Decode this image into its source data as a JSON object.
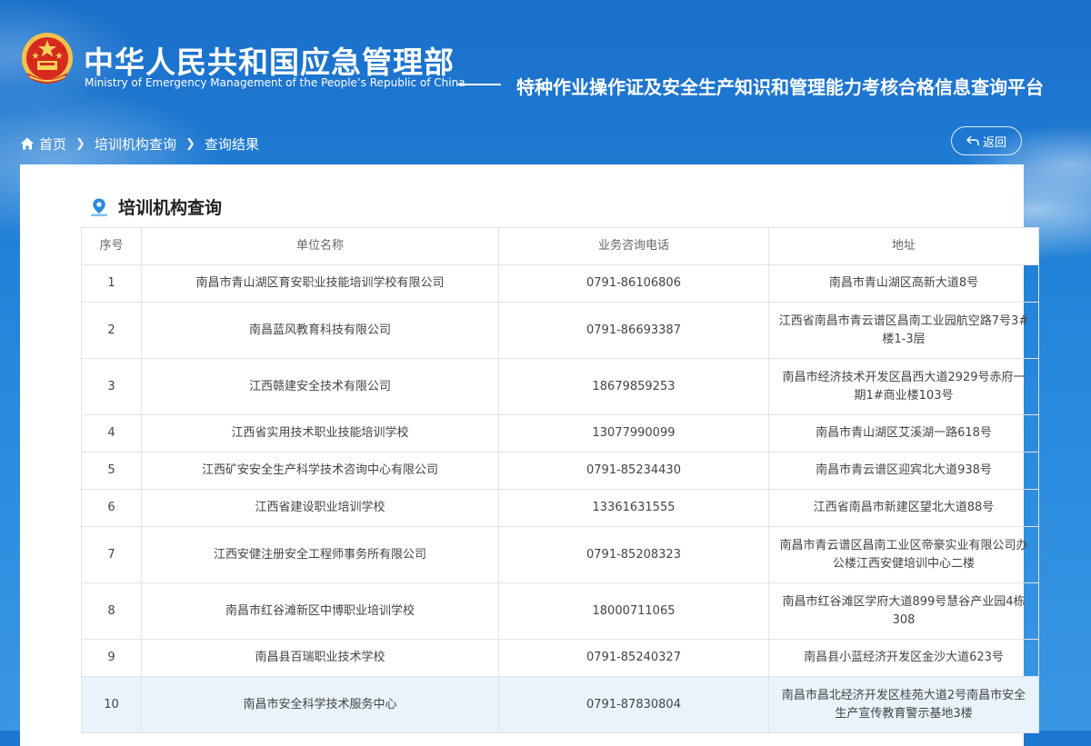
{
  "header": {
    "title_cn": "中华人民共和国应急管理部",
    "title_en": "Ministry of Emergency Management of the People’s Republic of China",
    "platform_title": "特种作业操作证及安全生产知识和管理能力考核合格信息查询平台"
  },
  "breadcrumb": {
    "items": [
      "首页",
      "培训机构查询",
      "查询结果"
    ]
  },
  "back_button": {
    "label": "返回"
  },
  "section": {
    "title": "培训机构查询"
  },
  "table": {
    "headers": [
      "序号",
      "单位名称",
      "业务咨询电话",
      "地址"
    ],
    "rows": [
      {
        "no": "1",
        "name": "南昌市青山湖区育安职业技能培训学校有限公司",
        "phone": "0791-86106806",
        "address": "南昌市青山湖区高新大道8号"
      },
      {
        "no": "2",
        "name": "南昌蓝风教育科技有限公司",
        "phone": "0791-86693387",
        "address": "江西省南昌市青云谱区昌南工业园航空路7号3#楼1-3层"
      },
      {
        "no": "3",
        "name": "江西赣建安全技术有限公司",
        "phone": "18679859253",
        "address": "南昌市经济技术开发区昌西大道2929号赤府一期1#商业楼103号"
      },
      {
        "no": "4",
        "name": "江西省实用技术职业技能培训学校",
        "phone": "13077990099",
        "address": "南昌市青山湖区艾溪湖一路618号"
      },
      {
        "no": "5",
        "name": "江西矿安安全生产科学技术咨询中心有限公司",
        "phone": "0791-85234430",
        "address": "南昌市青云谱区迎宾北大道938号"
      },
      {
        "no": "6",
        "name": "江西省建设职业培训学校",
        "phone": "13361631555",
        "address": "江西省南昌市新建区望北大道88号"
      },
      {
        "no": "7",
        "name": "江西安健注册安全工程师事务所有限公司",
        "phone": "0791-85208323",
        "address": "南昌市青云谱区昌南工业区帝豪实业有限公司办公楼江西安健培训中心二楼"
      },
      {
        "no": "8",
        "name": "南昌市红谷滩新区中博职业培训学校",
        "phone": "18000711065",
        "address": "南昌市红谷滩区学府大道899号慧谷产业园4栋308"
      },
      {
        "no": "9",
        "name": "南昌县百瑞职业技术学校",
        "phone": "0791-85240327",
        "address": "南昌县小蓝经济开发区金沙大道623号"
      },
      {
        "no": "10",
        "name": "南昌市安全科学技术服务中心",
        "phone": "0791-87830804",
        "address": "南昌市昌北经济开发区桂苑大道2号南昌市安全生产宣传教育警示基地3楼"
      }
    ]
  },
  "colors": {
    "sky": "#1c77d0",
    "panel": "#ffffff",
    "highlight_row": "#e8f3fc",
    "accent_icon": "#2a8be0"
  }
}
